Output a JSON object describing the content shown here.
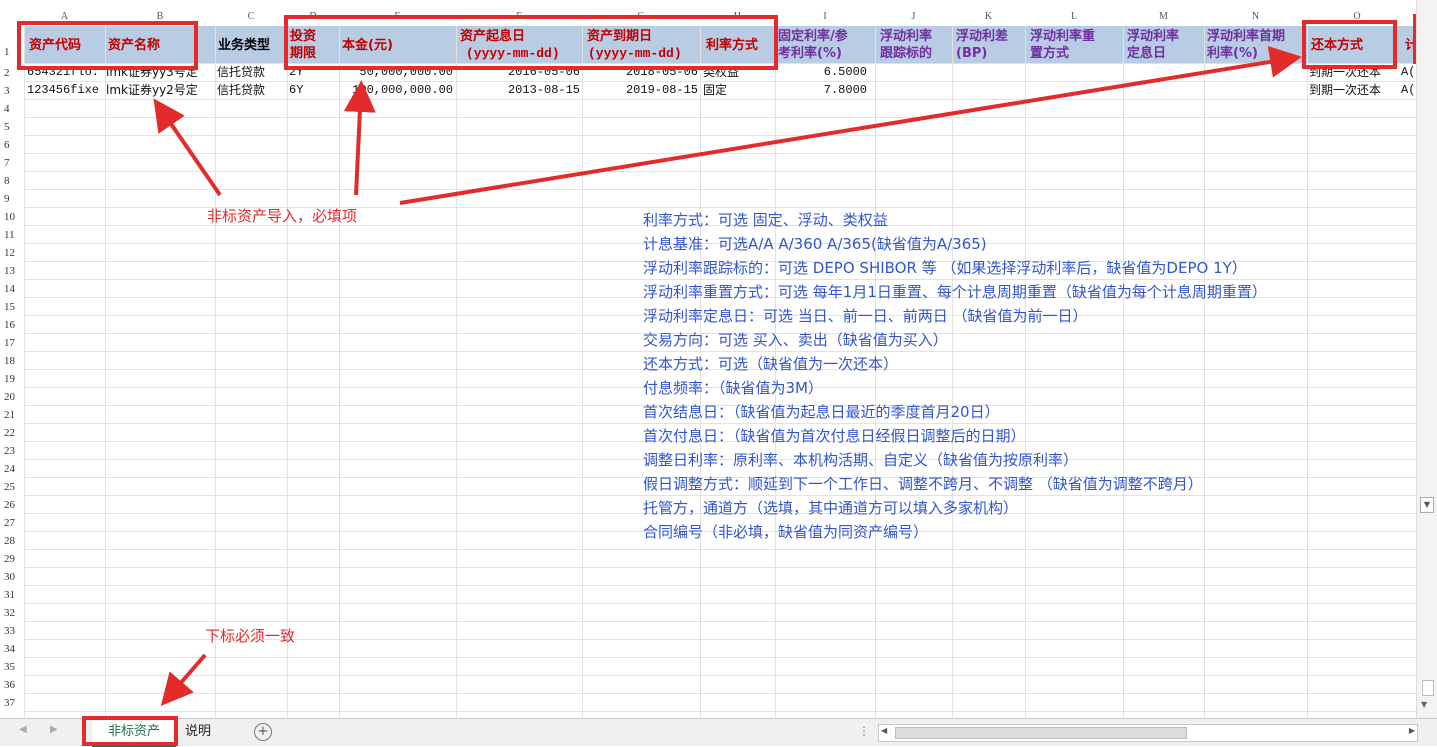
{
  "columns": [
    "A",
    "B",
    "C",
    "D",
    "E",
    "F",
    "G",
    "H",
    "I",
    "J",
    "K",
    "L",
    "M",
    "N",
    "O"
  ],
  "row_numbers": [
    "1",
    "2",
    "3",
    "4",
    "5",
    "6",
    "7",
    "8",
    "9",
    "10",
    "11",
    "12",
    "13",
    "14",
    "15",
    "16",
    "17",
    "18",
    "19",
    "20",
    "21",
    "22",
    "23",
    "24",
    "25",
    "26",
    "27",
    "28",
    "29",
    "30",
    "31",
    "32",
    "33",
    "34",
    "35",
    "36",
    "37"
  ],
  "headers": {
    "a": "资产代码",
    "b": "资产名称",
    "c": "业务类型",
    "d1": "投资",
    "d2": "期限",
    "e": "本金(元)",
    "f1": "资产起息日",
    "f2": "(yyyy-mm-dd)",
    "g1": "资产到期日",
    "g2": "(yyyy-mm-dd)",
    "h": "利率方式",
    "i1": "固定利率/参",
    "i2": "考利率(%)",
    "j1": "浮动利率",
    "j2": "跟踪标的",
    "k1": "浮动利差",
    "k2": "(BP)",
    "l1": "浮动利率重",
    "l2": "置方式",
    "m1": "浮动利率",
    "m2": "定息日",
    "n1": "浮动利率首期",
    "n2": "利率(%)",
    "o": "还本方式",
    "p": "计"
  },
  "rows": [
    {
      "a": "654321flo:",
      "b": "lmk证券yy3号定",
      "c": "信托贷款",
      "d": "2Y",
      "e": "50,000,000.00",
      "f": "2016-05-06",
      "g": "2018-05-06",
      "h": "类权益",
      "i": "6.5000",
      "o": "到期一次还本",
      "p": "A("
    },
    {
      "a": "123456fixe",
      "b": "lmk证券yy2号定",
      "c": "信托贷款",
      "d": "6Y",
      "e": "100,000,000.00",
      "f": "2013-08-15",
      "g": "2019-08-15",
      "h": "固定",
      "i": "7.8000",
      "o": "到期一次还本",
      "p": "A("
    }
  ],
  "annotations": {
    "required": "非标资产导入，必填项",
    "sheet_note": "下标必须一致"
  },
  "info_lines": [
    "利率方式：可选 固定、浮动、类权益",
    "计息基准：可选A/A A/360 A/365(缺省值为A/365)",
    "浮动利率跟踪标的：可选 DEPO SHIBOR 等 （如果选择浮动利率后，缺省值为DEPO 1Y）",
    "浮动利率重置方式：可选 每年1月1日重置、每个计息周期重置（缺省值为每个计息周期重置）",
    "浮动利率定息日：可选 当日、前一日、前两日 （缺省值为前一日）",
    "交易方向：可选 买入、卖出（缺省值为买入）",
    "还本方式：可选（缺省值为一次还本）",
    "付息频率：（缺省值为3M）",
    "首次结息日：（缺省值为起息日最近的季度首月20日）",
    "首次付息日：（缺省值为首次付息日经假日调整后的日期）",
    "调整日利率：原利率、本机构活期、自定义（缺省值为按原利率）",
    "假日调整方式：顺延到下一个工作日、调整不跨月、不调整 （缺省值为调整不跨月）",
    "托管方，通道方（选填，其中通道方可以填入多家机构）",
    "合同编号（非必填，缺省值为同资产编号）"
  ],
  "tabs": {
    "active": "非标资产",
    "second": "说明",
    "add": "+"
  },
  "colors": {
    "header_band": "#b8cce4",
    "required_text": "#c00000",
    "optional_text": "#7030a0",
    "annotation": "#e32b2b",
    "info_text": "#3355cc",
    "active_tab": "#217346"
  }
}
